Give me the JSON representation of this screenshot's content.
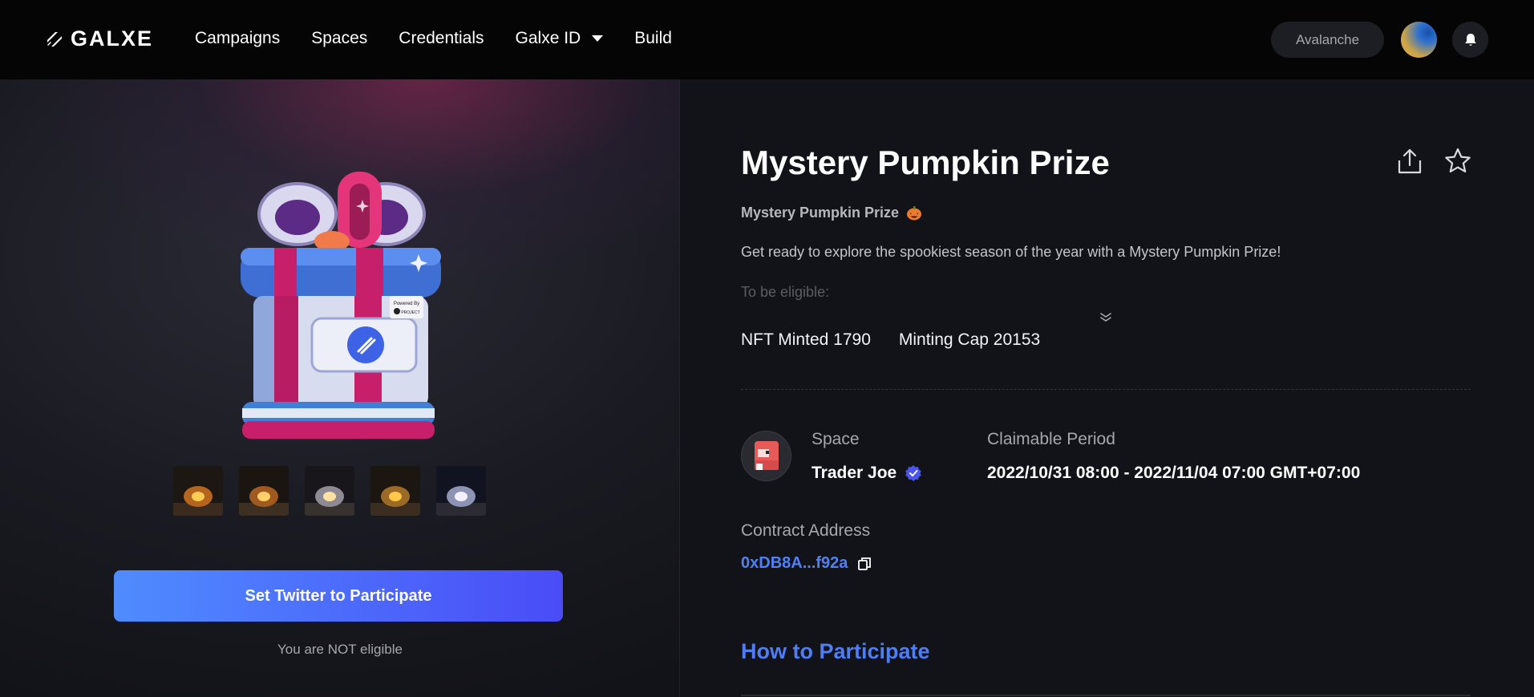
{
  "brand": {
    "name": "GALXE"
  },
  "nav": {
    "items": [
      {
        "label": "Campaigns"
      },
      {
        "label": "Spaces"
      },
      {
        "label": "Credentials"
      },
      {
        "label": "Galxe ID"
      },
      {
        "label": "Build"
      }
    ]
  },
  "header": {
    "chain": "Avalanche"
  },
  "campaign": {
    "title": "Mystery Pumpkin Prize",
    "subtitle": "Mystery Pumpkin Prize",
    "description": "Get ready to explore the spookiest season of the year with a Mystery Pumpkin Prize!",
    "description_more": "To be eligible:",
    "stats": {
      "minted_label": "NFT Minted",
      "minted_value": "1790",
      "cap_label": "Minting Cap",
      "cap_value": "20153"
    },
    "space_label": "Space",
    "space_name": "Trader Joe",
    "period_label": "Claimable Period",
    "period_value": "2022/10/31 08:00 - 2022/11/04 07:00 GMT+07:00",
    "contract_label": "Contract Address",
    "contract_value": "0xDB8A...f92a",
    "how_to": "How to Participate"
  },
  "cta": {
    "label": "Set Twitter to Participate",
    "eligibility": "You are NOT eligible"
  },
  "colors": {
    "accent": "#4f80f7",
    "cta_start": "#4f8cff",
    "cta_end": "#4a4cf7",
    "verified": "#4a55f0",
    "background": "#121318"
  },
  "icons": [
    "galxe-logo-icon",
    "chevron-down-icon",
    "bell-icon",
    "share-icon",
    "star-icon",
    "pumpkin-emoji-icon",
    "double-chevron-down-icon",
    "verified-icon",
    "copy-icon"
  ]
}
